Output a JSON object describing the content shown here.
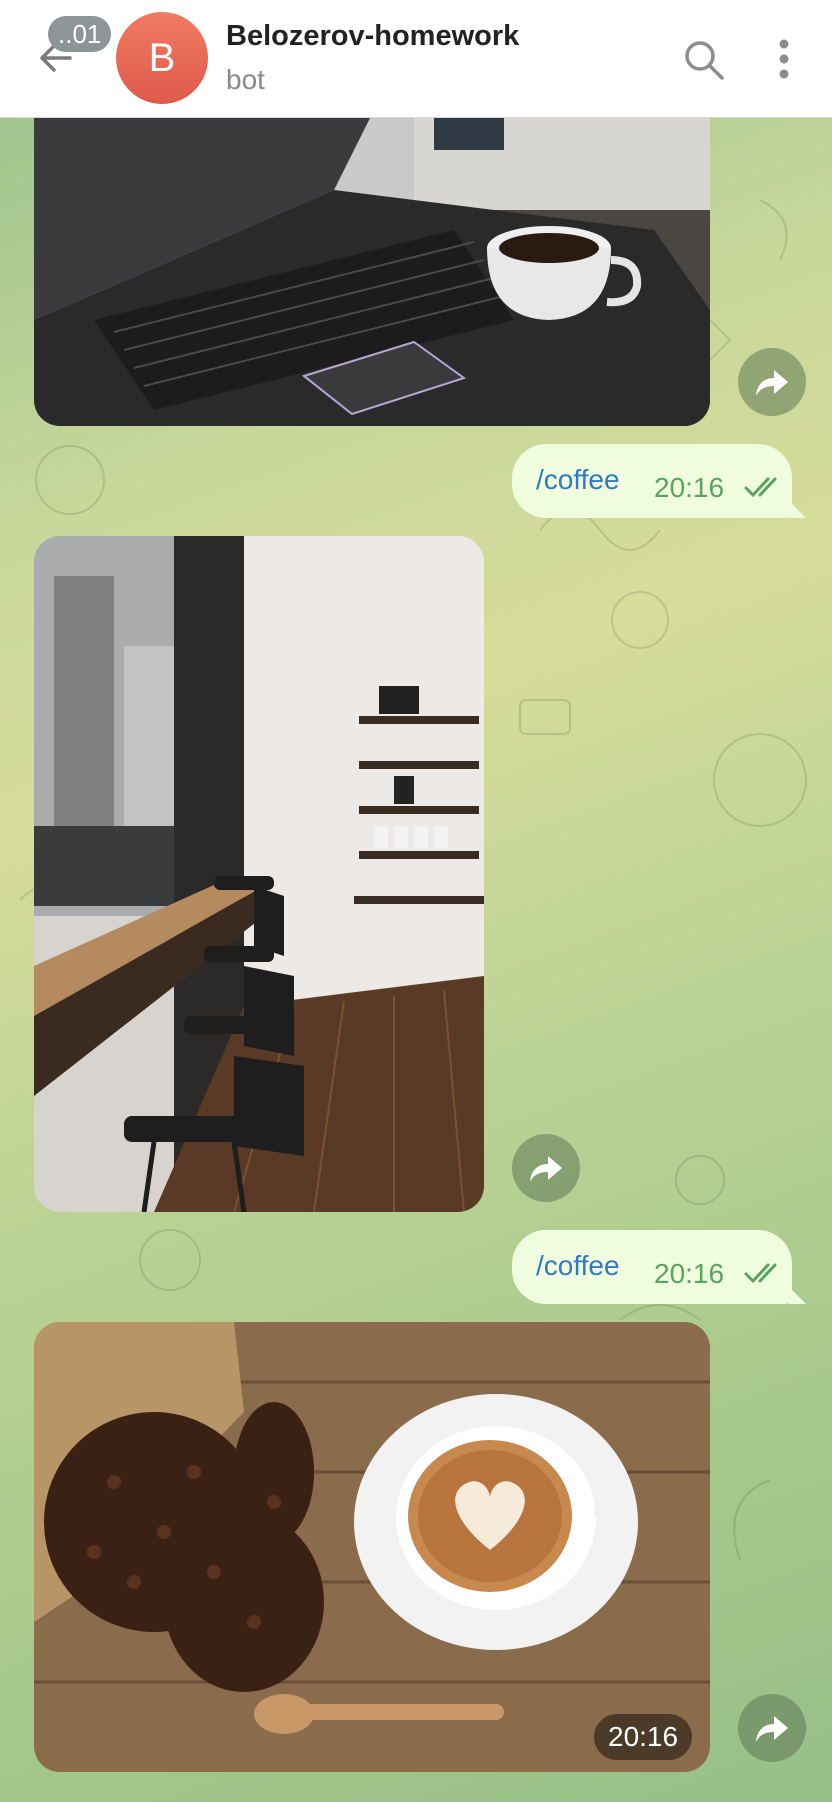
{
  "header": {
    "back_badge": "..01",
    "avatar_letter": "B",
    "title": "Belozerov-homework",
    "subtitle": "bot"
  },
  "messages": [
    {
      "type": "photo",
      "subject": "laptop with coffee cup"
    },
    {
      "type": "outgoing",
      "text": "/coffee",
      "time": "20:16",
      "status": "read"
    },
    {
      "type": "photo",
      "subject": "cafe interior with bar stools"
    },
    {
      "type": "outgoing",
      "text": "/coffee",
      "time": "20:16",
      "status": "read"
    },
    {
      "type": "photo",
      "subject": "latte art with coffee beans",
      "time": "20:16"
    }
  ],
  "icons": {
    "back": "arrow-left-icon",
    "search": "search-icon",
    "menu": "more-vertical-icon",
    "forward": "forward-arrow-icon",
    "read": "double-check-icon"
  },
  "colors": {
    "accent": "#2f79c6",
    "bubble": "#effdde",
    "time_green": "#5aa35e",
    "avatar": "#e5644f"
  }
}
